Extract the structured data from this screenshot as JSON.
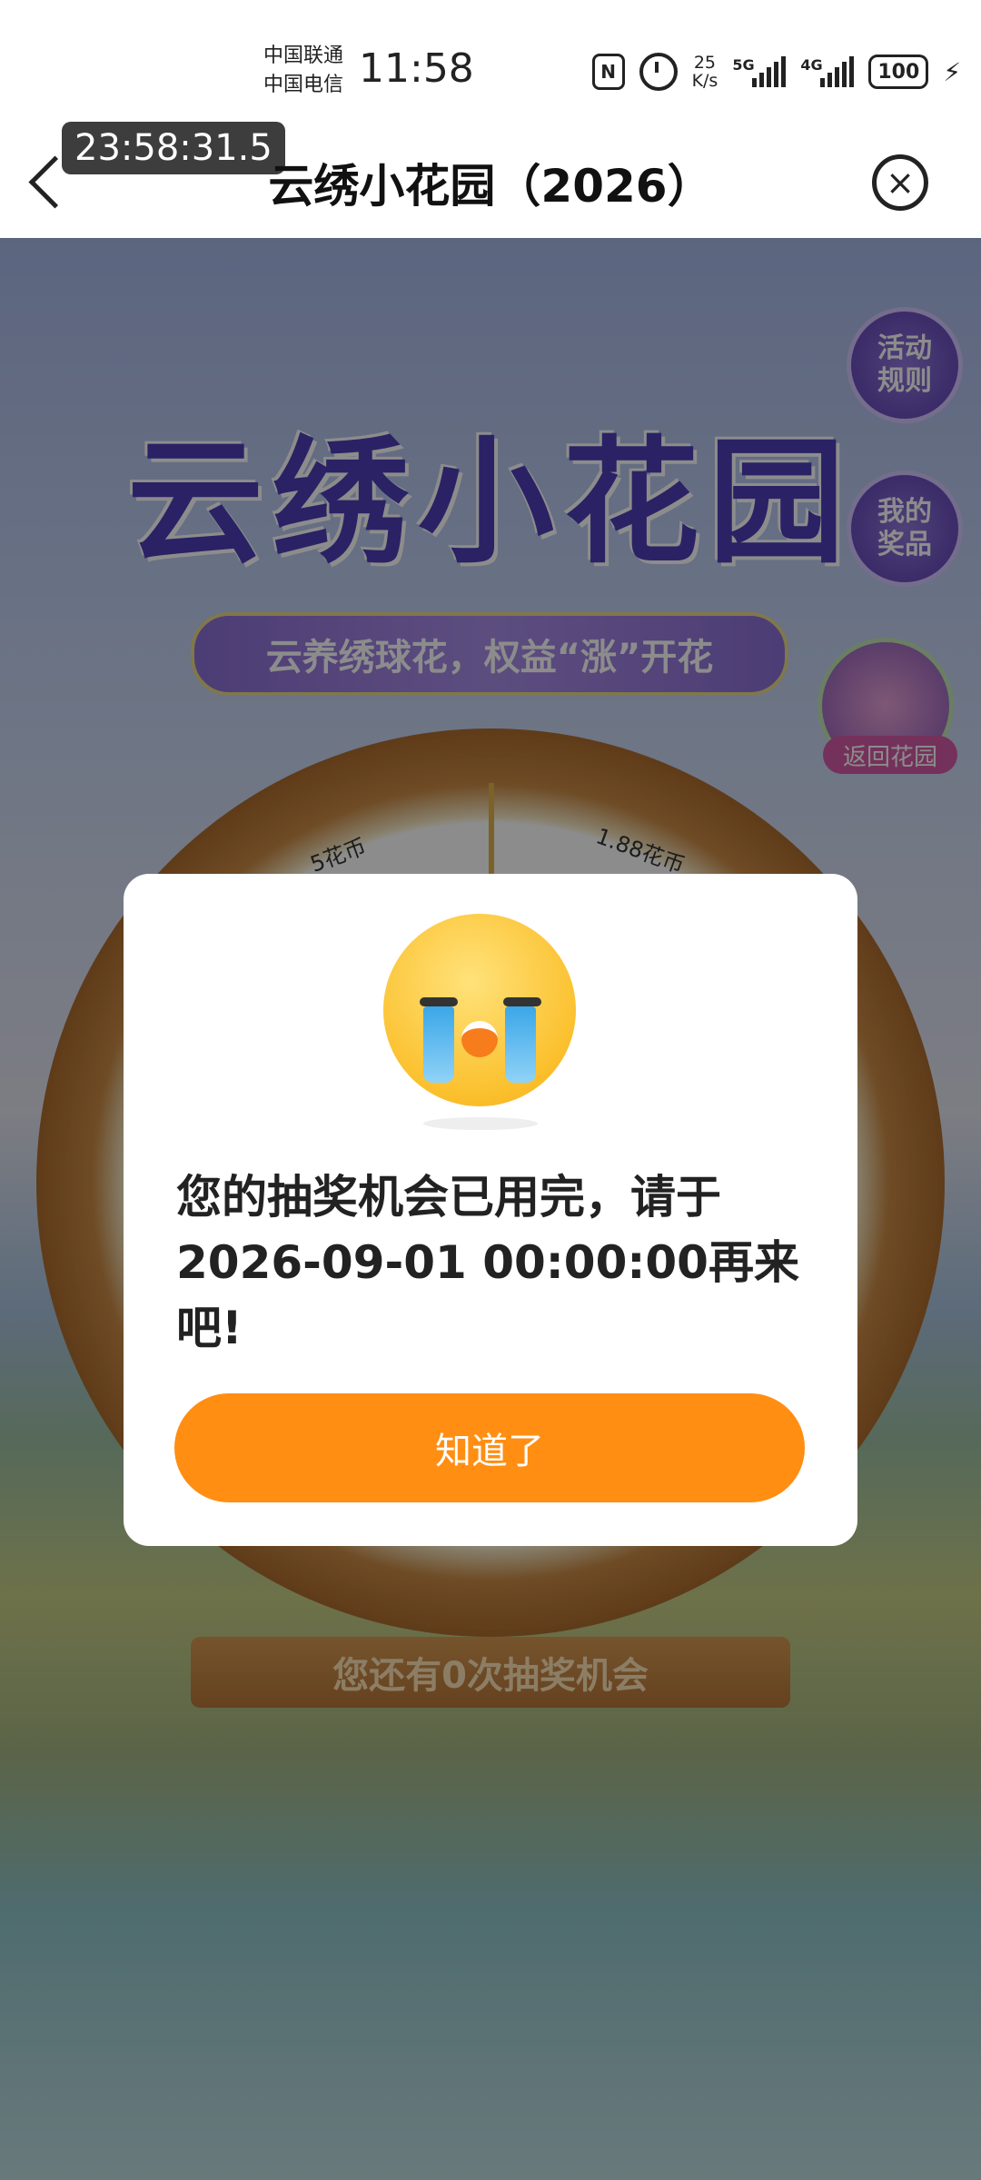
{
  "status_bar": {
    "carrier_1": "中国联通",
    "carrier_2": "中国电信",
    "time": "11:58",
    "net_speed_value": "25",
    "net_speed_unit": "K/s",
    "signal_1_label": "5G",
    "signal_2_label": "4G",
    "battery": "100",
    "icons": [
      "nfc-icon",
      "alarm-icon",
      "signal-icon",
      "battery-icon",
      "charging-icon"
    ]
  },
  "header": {
    "title": "云绣小花园（2026）",
    "timer": "23:58:31.5"
  },
  "game": {
    "banner_title": "云绣小花园",
    "slogan": "云养绣球花，权益“涨”开花",
    "side_buttons": {
      "rules": "活动\n规则",
      "my_prizes": "我的\n奖品",
      "return_garden": "返回花园"
    },
    "prizes": [
      "5花币",
      "1.88花币"
    ],
    "chance_text": "您还有0次抽奖机会"
  },
  "dialog": {
    "message": "您的抽奖机会已用完，请于2026-09-01 00:00:00再来吧!",
    "button_label": "知道了",
    "icon": "crying-face-icon"
  },
  "colors": {
    "accent": "#ff8e12",
    "dialog_bg": "#ffffff",
    "overlay": "rgba(0,0,0,0.45)"
  }
}
